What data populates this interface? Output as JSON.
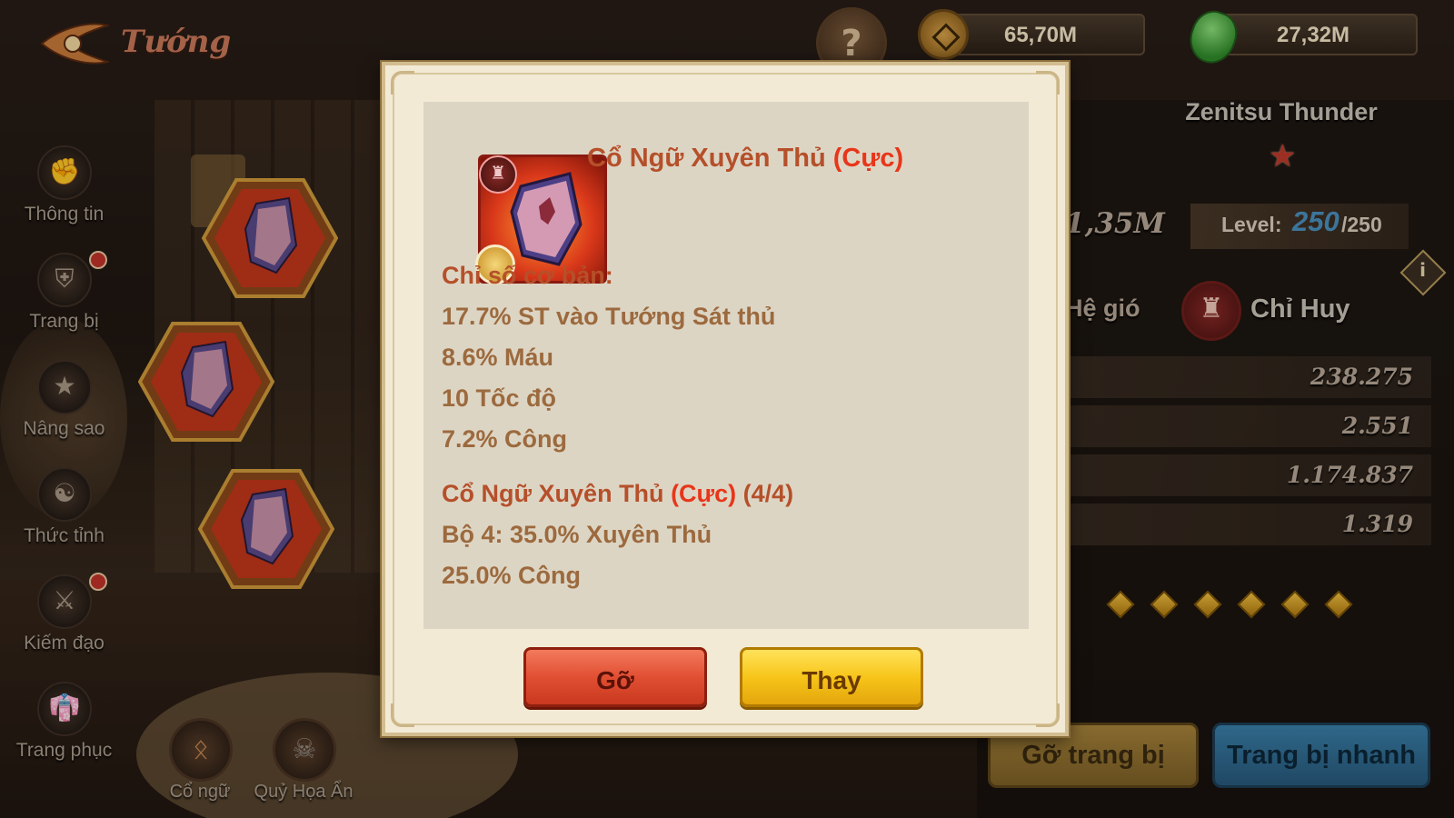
{
  "header": {
    "title": "Tướng",
    "gold": "65,70M",
    "jade": "27,32M"
  },
  "sidebar": {
    "items": [
      {
        "label": "Thông tin",
        "icon": "muscle-icon",
        "badge": false
      },
      {
        "label": "Trang bị",
        "icon": "armor-icon",
        "badge": true
      },
      {
        "label": "Nâng sao",
        "icon": "star-icon",
        "badge": false
      },
      {
        "label": "Thức tỉnh",
        "icon": "awaken-icon",
        "badge": false
      },
      {
        "label": "Kiếm đạo",
        "icon": "sword-icon",
        "badge": true
      },
      {
        "label": "Trang phục",
        "icon": "outfit-icon",
        "badge": false
      }
    ]
  },
  "bottom_tabs": [
    {
      "label": "Cổ ngữ",
      "icon": "rune-icon"
    },
    {
      "label": "Quỷ Họa Ẩn",
      "icon": "demon-icon"
    }
  ],
  "hero": {
    "name": "Zenitsu Thunder",
    "power": "1,35M",
    "level_label": "Level:",
    "level": "250",
    "level_max": "/250",
    "element": "Hệ gió",
    "class": "Chỉ Huy",
    "stats": [
      "238.275",
      "2.551",
      "1.174.837",
      "1.319"
    ],
    "unequip_all_label": "Gỡ trang bị",
    "quick_equip_label": "Trang bị nhanh"
  },
  "popup": {
    "item_name": "Cổ Ngữ Xuyên Thủ",
    "item_rarity": "(Cực)",
    "base_stats_title": "Chỉ số cơ bản:",
    "base_stats": [
      "17.7% ST vào Tướng Sát thủ",
      "8.6% Máu",
      "10 Tốc độ",
      "7.2% Công"
    ],
    "set_name": "Cổ Ngữ Xuyên Thủ",
    "set_rarity": "(Cực)",
    "set_count": "(4/4)",
    "set_bonus": [
      "Bộ 4: 35.0% Xuyên Thủ",
      "25.0% Công"
    ],
    "remove_label": "Gỡ",
    "replace_label": "Thay"
  },
  "colors": {
    "title_red": "#b5502a",
    "rarity_red": "#e8361a",
    "stat_brown": "#9c6a3e",
    "remove_btn": "#e14f33",
    "replace_btn": "#f7c51a"
  }
}
